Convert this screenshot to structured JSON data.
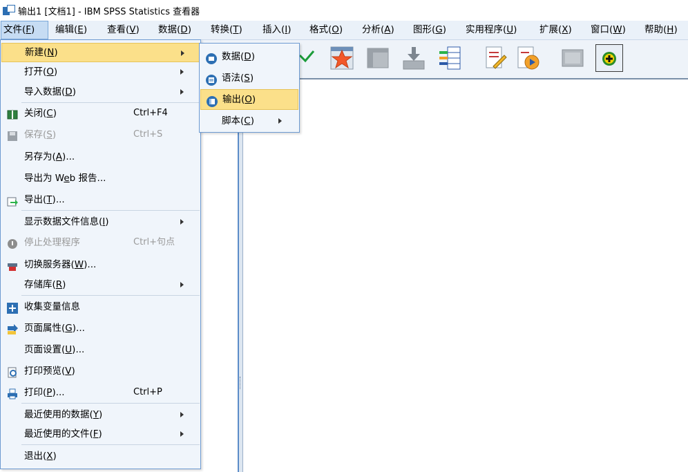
{
  "window": {
    "title": "输出1 [文档1] - IBM SPSS Statistics 查看器"
  },
  "menubar": [
    {
      "label": "文件",
      "key": "F"
    },
    {
      "label": "编辑",
      "key": "E"
    },
    {
      "label": "查看",
      "key": "V"
    },
    {
      "label": "数据",
      "key": "D"
    },
    {
      "label": "转换",
      "key": "T"
    },
    {
      "label": "插入",
      "key": "I"
    },
    {
      "label": "格式",
      "key": "O"
    },
    {
      "label": "分析",
      "key": "A"
    },
    {
      "label": "图形",
      "key": "G"
    },
    {
      "label": "实用程序",
      "key": "U"
    },
    {
      "label": "扩展",
      "key": "X"
    },
    {
      "label": "窗口",
      "key": "W"
    },
    {
      "label": "帮助",
      "key": "H"
    }
  ],
  "file_menu": [
    {
      "label": "新建",
      "key": "N",
      "tail": "",
      "shortcut": "",
      "submenu": true,
      "icon": ""
    },
    {
      "label": "打开",
      "key": "O",
      "tail": "",
      "shortcut": "",
      "submenu": true,
      "icon": ""
    },
    {
      "label": "导入数据",
      "key": "D",
      "tail": "",
      "shortcut": "",
      "submenu": true,
      "icon": ""
    },
    {
      "label": "关闭",
      "key": "C",
      "tail": "",
      "shortcut": "Ctrl+F4",
      "submenu": false,
      "icon": "close-window-icon"
    },
    {
      "label": "保存",
      "key": "S",
      "tail": "",
      "shortcut": "Ctrl+S",
      "submenu": false,
      "icon": "save-icon",
      "disabled": true
    },
    {
      "label": "另存为",
      "key": "A",
      "tail": "...",
      "shortcut": "",
      "submenu": false,
      "icon": ""
    },
    {
      "label": "导出为 W",
      "key": "e",
      "tail": "b 报告...",
      "shortcut": "",
      "submenu": false,
      "icon": ""
    },
    {
      "label": "导出",
      "key": "T",
      "tail": "...",
      "shortcut": "",
      "submenu": false,
      "icon": "export-icon"
    },
    {
      "label": "显示数据文件信息",
      "key": "I",
      "tail": "",
      "shortcut": "",
      "submenu": true,
      "icon": ""
    },
    {
      "label": "停止处理程序",
      "key": "",
      "tail": "",
      "shortcut": "Ctrl+句点",
      "submenu": false,
      "icon": "stop-icon",
      "disabled": true
    },
    {
      "label": "切换服务器",
      "key": "W",
      "tail": "...",
      "shortcut": "",
      "submenu": false,
      "icon": "server-icon"
    },
    {
      "label": "存储库",
      "key": "R",
      "tail": "",
      "shortcut": "",
      "submenu": true,
      "icon": ""
    },
    {
      "label": "收集变量信息",
      "key": "",
      "tail": "",
      "shortcut": "",
      "submenu": false,
      "icon": "plus-icon"
    },
    {
      "label": "页面属性",
      "key": "G",
      "tail": "...",
      "shortcut": "",
      "submenu": false,
      "icon": "page-attributes-icon"
    },
    {
      "label": "页面设置",
      "key": "U",
      "tail": "...",
      "shortcut": "",
      "submenu": false,
      "icon": ""
    },
    {
      "label": "打印预览",
      "key": "V",
      "tail": "",
      "shortcut": "",
      "submenu": false,
      "icon": "print-preview-icon"
    },
    {
      "label": "打印",
      "key": "P",
      "tail": "...",
      "shortcut": "Ctrl+P",
      "submenu": false,
      "icon": "printer-icon"
    },
    {
      "label": "最近使用的数据",
      "key": "Y",
      "tail": "",
      "shortcut": "",
      "submenu": true,
      "icon": ""
    },
    {
      "label": "最近使用的文件",
      "key": "F",
      "tail": "",
      "shortcut": "",
      "submenu": true,
      "icon": ""
    },
    {
      "label": "退出",
      "key": "X",
      "tail": "",
      "shortcut": "",
      "submenu": false,
      "icon": ""
    }
  ],
  "new_submenu": [
    {
      "label": "数据",
      "key": "D",
      "icon": "data-icon",
      "submenu": false
    },
    {
      "label": "语法",
      "key": "S",
      "icon": "syntax-icon",
      "submenu": false
    },
    {
      "label": "输出",
      "key": "O",
      "icon": "output-icon",
      "submenu": false,
      "highlighted": true
    },
    {
      "label": "脚本",
      "key": "C",
      "icon": "",
      "submenu": true
    }
  ],
  "toolbar_icons": [
    "go-to-data-icon",
    "designate-window-icon",
    "find-icon",
    "insert-chart-icon",
    "insert-text-icon",
    "insert-title-icon",
    "export-icon",
    "promote-icon",
    "show-icon",
    "plus-icon"
  ],
  "colors": {
    "menu_bg": "#f0f5fb",
    "highlight": "#fbe08a",
    "accent": "#2d6fb3"
  }
}
